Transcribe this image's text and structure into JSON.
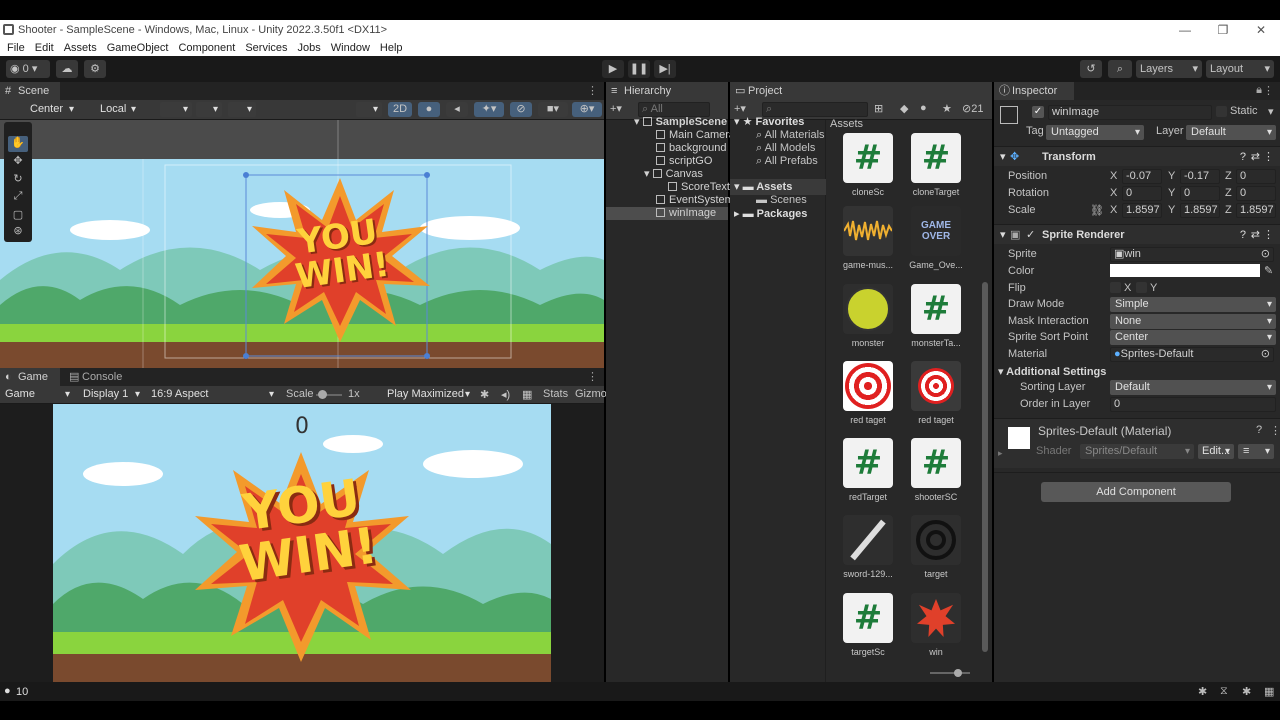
{
  "window": {
    "title": "Shooter - SampleScene - Windows, Mac, Linux - Unity 2022.3.50f1 <DX11>",
    "controls": [
      "—",
      "❐",
      "✕"
    ]
  },
  "menu": [
    "File",
    "Edit",
    "Assets",
    "GameObject",
    "Component",
    "Services",
    "Jobs",
    "Window",
    "Help"
  ],
  "toolbar": {
    "account_count": "0",
    "layers_label": "Layers",
    "layout_label": "Layout"
  },
  "scene": {
    "tab": "Scene",
    "pivot": "Center",
    "space": "Local",
    "mode_2d": "2D",
    "sprite_text_line1": "YOU",
    "sprite_text_line2": "WIN!"
  },
  "game": {
    "tab_game": "Game",
    "tab_console": "Console",
    "view": "Game",
    "display": "Display 1",
    "aspect": "16:9 Aspect",
    "scale_label": "Scale",
    "scale_value": "1x",
    "play_mode": "Play Maximized",
    "stats": "Stats",
    "gizmos": "Gizmo",
    "score": "0",
    "banner_line1": "YOU",
    "banner_line2": "WIN!"
  },
  "hierarchy": {
    "tab": "Hierarchy",
    "search_placeholder": "All",
    "items": [
      {
        "label": "SampleScene",
        "level": 0
      },
      {
        "label": "Main Camera",
        "level": 1
      },
      {
        "label": "background",
        "level": 1
      },
      {
        "label": "scriptGO",
        "level": 1
      },
      {
        "label": "Canvas",
        "level": 1
      },
      {
        "label": "ScoreText",
        "level": 2
      },
      {
        "label": "EventSystem",
        "level": 1
      },
      {
        "label": "winImage",
        "level": 1
      }
    ]
  },
  "project": {
    "tab": "Project",
    "hidden_count": "21",
    "favorites_label": "Favorites",
    "favorites": [
      "All Materials",
      "All Models",
      "All Prefabs"
    ],
    "assets_label": "Assets",
    "assets_children": [
      "Scenes"
    ],
    "packages_label": "Packages",
    "breadcrumb": "Assets",
    "assets": [
      {
        "name": "cloneSc",
        "kind": "script"
      },
      {
        "name": "cloneTarget",
        "kind": "script"
      },
      {
        "name": "game-mus...",
        "kind": "audio"
      },
      {
        "name": "Game_Ove...",
        "kind": "gameover"
      },
      {
        "name": "monster",
        "kind": "monster"
      },
      {
        "name": "monsterTa...",
        "kind": "script"
      },
      {
        "name": "red taget",
        "kind": "target-red"
      },
      {
        "name": "red taget",
        "kind": "target-red-small"
      },
      {
        "name": "redTarget",
        "kind": "script"
      },
      {
        "name": "shooterSC",
        "kind": "script"
      },
      {
        "name": "sword-129...",
        "kind": "sword"
      },
      {
        "name": "target",
        "kind": "crosshair"
      },
      {
        "name": "targetSc",
        "kind": "script"
      },
      {
        "name": "win",
        "kind": "win"
      }
    ]
  },
  "inspector": {
    "tab": "Inspector",
    "object_name": "winImage",
    "static_label": "Static",
    "tag_label": "Tag",
    "tag_value": "Untagged",
    "layer_label": "Layer",
    "layer_value": "Default",
    "transform": {
      "title": "Transform",
      "position_label": "Position",
      "rotation_label": "Rotation",
      "scale_label": "Scale",
      "position": [
        "-0.07",
        "-0.17",
        "0"
      ],
      "rotation": [
        "0",
        "0",
        "0"
      ],
      "scale": [
        "1.8597",
        "1.8597",
        "1.8597"
      ]
    },
    "sprite_renderer": {
      "title": "Sprite Renderer",
      "sprite_label": "Sprite",
      "sprite_value": "win",
      "color_label": "Color",
      "color_value": "#ffffff",
      "flip_label": "Flip",
      "flip_x": "X",
      "flip_y": "Y",
      "draw_mode_label": "Draw Mode",
      "draw_mode": "Simple",
      "mask_label": "Mask Interaction",
      "mask": "None",
      "sort_point_label": "Sprite Sort Point",
      "sort_point": "Center",
      "material_label": "Material",
      "material": "Sprites-Default",
      "additional_label": "Additional Settings",
      "sorting_layer_label": "Sorting Layer",
      "sorting_layer": "Default",
      "order_label": "Order in Layer",
      "order": "0"
    },
    "material_block": {
      "name": "Sprites-Default (Material)",
      "shader_label": "Shader",
      "shader": "Sprites/Default",
      "edit": "Edit..."
    },
    "add_component": "Add Component"
  },
  "status": {
    "count": "10"
  },
  "colors": {
    "accent_blue": "#2c5d87",
    "sky": "#9fd4ef",
    "grass": "#79c23a",
    "starburst_red": "#e0402a",
    "starburst_orange": "#f5a623",
    "text_yellow": "#ffd23c"
  }
}
